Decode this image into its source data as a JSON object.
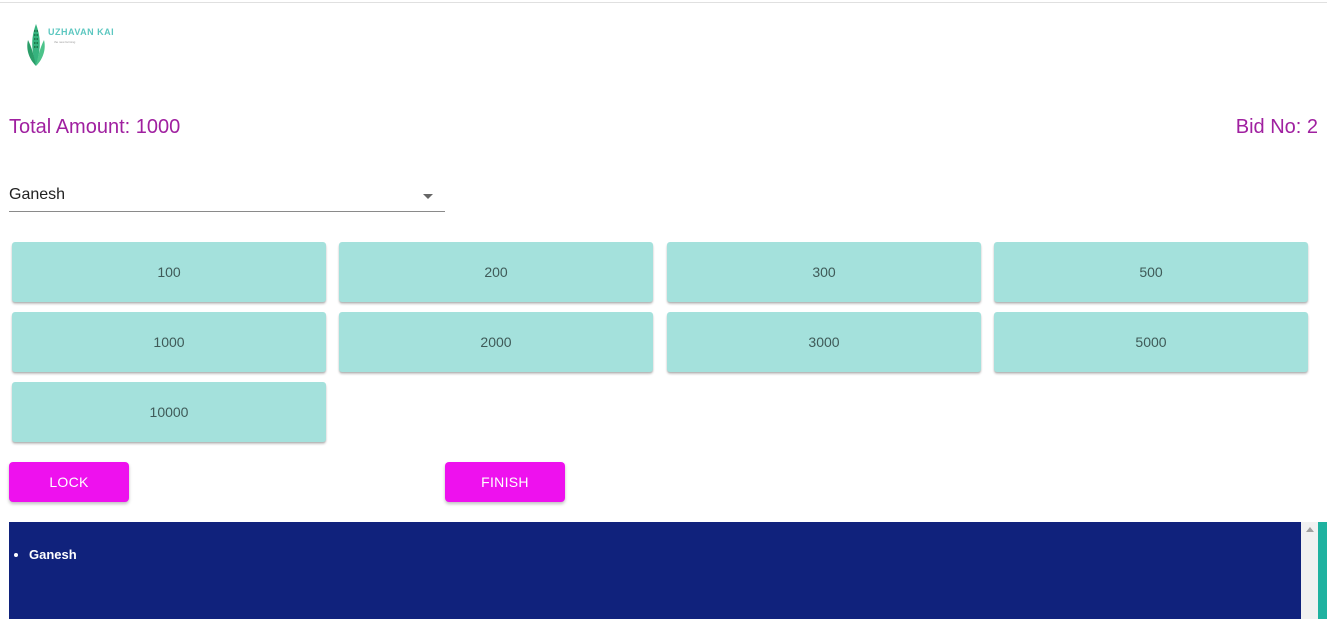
{
  "logo": {
    "brand": "UZHAVAN KAI",
    "tagline": "the new farming"
  },
  "header": {
    "total_amount": "Total Amount: 1000",
    "bid_no": "Bid No: 2"
  },
  "bidder_select": {
    "value": "Ganesh"
  },
  "amount_buttons": [
    "100",
    "200",
    "300",
    "500",
    "1000",
    "2000",
    "3000",
    "5000",
    "10000"
  ],
  "actions": {
    "lock": "LOCK",
    "finish": "FINISH"
  },
  "bidders_list": [
    "Ganesh"
  ],
  "colors": {
    "accent_text": "#a020a0",
    "amount_button": "#a4e1dc",
    "action_button": "#ee11ee",
    "panel_bg": "#10227c"
  }
}
